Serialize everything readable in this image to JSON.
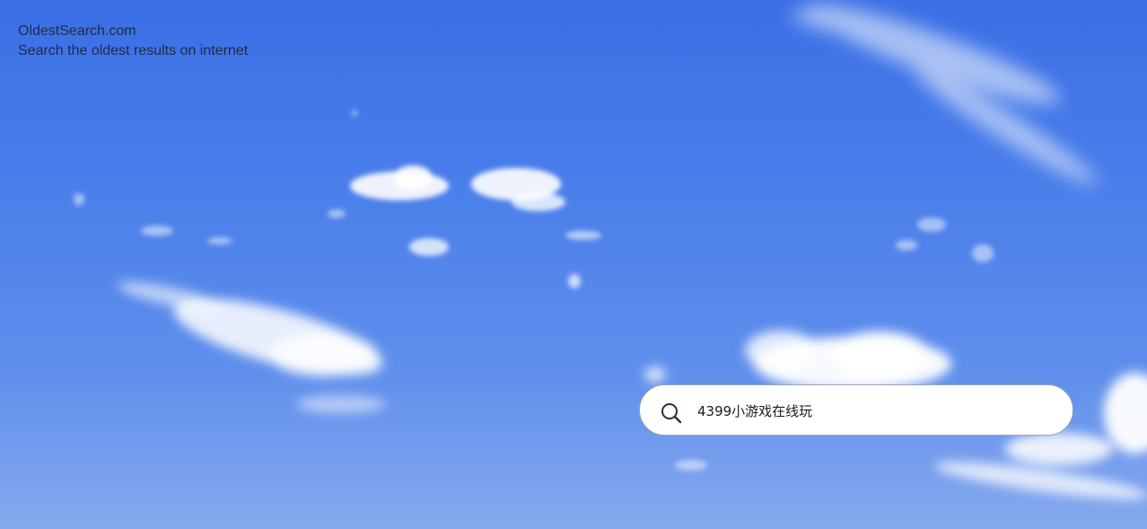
{
  "site": {
    "name": "OldestSearch.com",
    "tagline": "Search the oldest results on internet"
  },
  "search": {
    "value": "4399小游戏在线玩",
    "placeholder": "",
    "icon": "search-icon"
  },
  "colors": {
    "sky_top": "#3a6fe6",
    "sky_bottom": "#86a9ee",
    "text": "#1f2a44",
    "search_bg": "#ffffff"
  }
}
